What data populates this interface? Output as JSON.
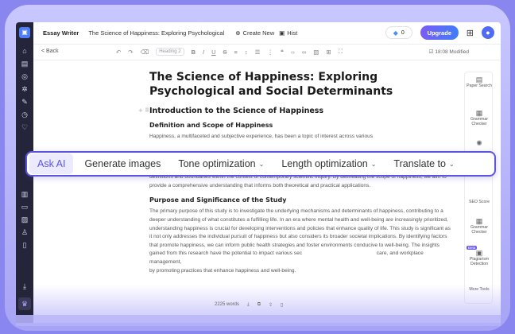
{
  "topbar": {
    "app_name": "Essay Writer",
    "doc_title": "The Science of Happiness: Exploring Psychological",
    "create_new": "Create New",
    "history": "Hist",
    "credits": "0",
    "upgrade": "Upgrade"
  },
  "toolbar": {
    "back": "< Back",
    "heading_select": "Heading 2",
    "modified": "18:08 Modified"
  },
  "document": {
    "title": "The Science of Happiness: Exploring Psychological and Social Determinants",
    "h2_intro": "Introduction to the Science of Happiness",
    "h3_definition": "Definition and Scope of Happiness",
    "p1_line1": "Happiness, a multifaceted and subjective experience, has been a topic of interest across various",
    "p1_rest": "circumstances and the presence of positive affect. This paper seeks to explore the complex nature of happiness, examining its definitions and boundaries within the context of contemporary scientific inquiry. By delineating the scope of happiness, we aim to provide a comprehensive understanding that informs both theoretical and practical applications.",
    "h3_purpose": "Purpose and Significance of the Study",
    "p2": "The primary purpose of this study is to investigate the underlying mechanisms and determinants of happiness, contributing to a deeper understanding of what constitutes a fulfilling life. In an era where mental health and well-being are increasingly prioritized, understanding happiness is crucial for developing interventions and policies that enhance quality of life. This study is significant as it not only addresses the individual pursuit of happiness but also considers its broader societal implications. By identifying factors that promote happiness, we can inform public health strategies and foster environments conducive to well-being. The insights gained from this research have the potential to impact various sec",
    "p2_tail": "care, and workplace management,",
    "p3": "by promoting practices that enhance happiness and well-being."
  },
  "ai_bar": {
    "ask_ai": "Ask AI",
    "generate_images": "Generate images",
    "tone": "Tone optimization",
    "length": "Length optimization",
    "translate": "Translate to"
  },
  "right_sidebar": {
    "paper_search": "Paper Search",
    "grammar_checker": "Grammar Checker",
    "seo_score": "SEO Score",
    "grammar_checker_2": "Grammar Checker",
    "beta": "Beta",
    "plagiarism": "Plagiarism Detection",
    "more_tools": "More Tools"
  },
  "status": {
    "word_count": "2225 words"
  },
  "colors": {
    "accent": "#5b55e0",
    "rail": "#24243a",
    "upgrade_start": "#7b5cf5",
    "upgrade_end": "#3f7df7"
  }
}
